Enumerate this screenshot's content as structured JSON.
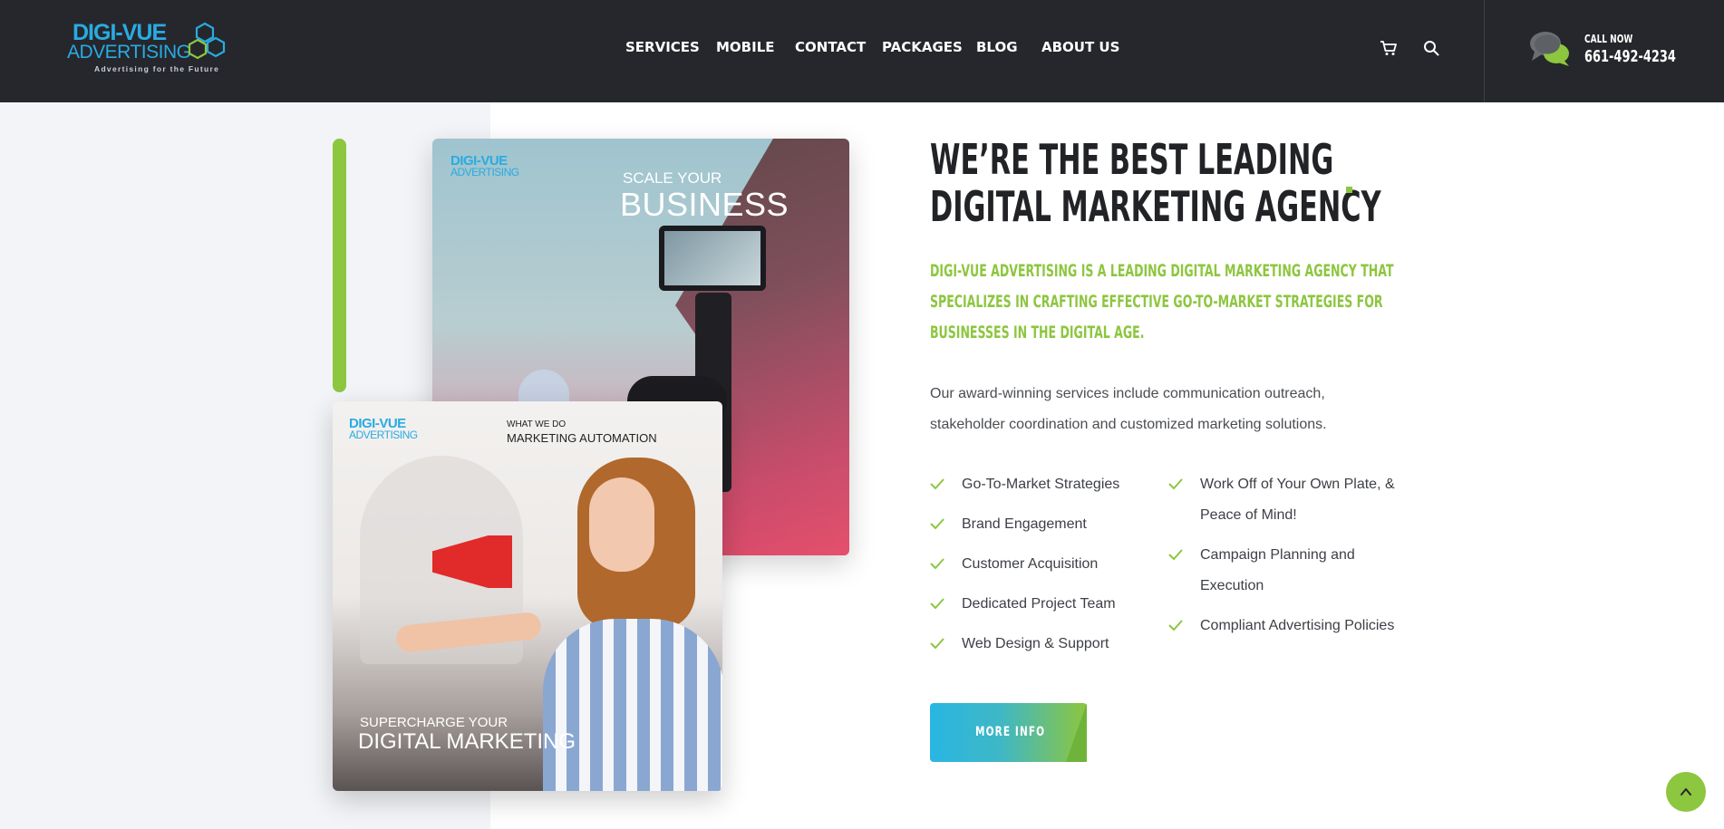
{
  "brand": {
    "logo_line1": "DIGI-VUE",
    "logo_line2": "ADVERTISING",
    "tagline": "Advertising for the Future"
  },
  "nav": {
    "items": [
      "SERVICES",
      "MOBILE",
      "CONTACT",
      "PACKAGES",
      "BLOG",
      "ABOUT US"
    ]
  },
  "header": {
    "call_label": "CALL NOW",
    "phone": "661-492-4234",
    "cart_icon": "cart-icon",
    "search_icon": "search-icon",
    "chat_icon": "chat-bubbles-icon"
  },
  "images": {
    "top": {
      "brand_line1": "DIGI-VUE",
      "brand_line2": "ADVERTISING",
      "headline_small": "SCALE YOUR",
      "headline_large": "BUSINESS"
    },
    "bottom": {
      "brand_line1": "DIGI-VUE",
      "brand_line2": "ADVERTISING",
      "kicker": "WHAT WE DO",
      "topic": "MARKETING AUTOMATION",
      "headline_small": "SUPERCHARGE YOUR",
      "headline_large": "DIGITAL MARKETING"
    }
  },
  "main": {
    "title_line1": "WE’RE THE BEST LEADING",
    "title_line2": "DIGITAL MARKETING AGENCY",
    "subtitle_line1": "DIGI-VUE ADVERTISING IS A LEADING DIGITAL MARKETING AGENCY THAT",
    "subtitle_line2": "SPECIALIZES IN CRAFTING EFFECTIVE GO-TO-MARKET STRATEGIES FOR",
    "subtitle_line3": "BUSINESSES IN THE DIGITAL AGE.",
    "description_line1": "Our award-winning services include communication outreach,",
    "description_line2": "stakeholder coordination and customized marketing solutions.",
    "features_left": [
      "Go-To-Market Strategies",
      "Brand Engagement",
      "Customer Acquisition",
      "Dedicated Project Team",
      "Web Design & Support"
    ],
    "features_right": [
      "Work Off of Your Own Plate, & Peace of Mind!",
      "Campaign Planning and Execution",
      "Compliant Advertising Policies"
    ],
    "cta_label": "MORE INFO"
  },
  "colors": {
    "header_bg": "#25272c",
    "accent_green": "#8dc63f",
    "accent_blue": "#29abe2",
    "heading": "#222326",
    "body_text": "#4a4d52"
  }
}
